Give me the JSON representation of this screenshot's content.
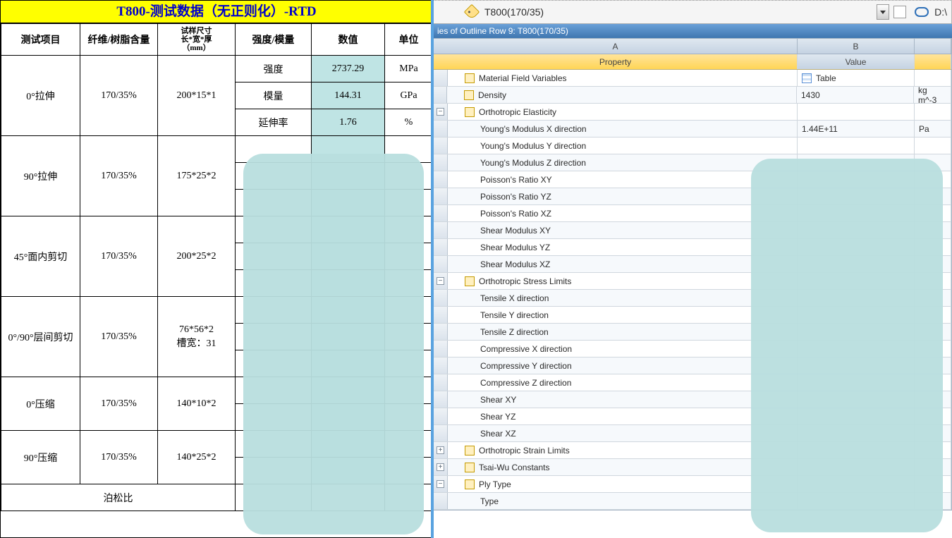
{
  "sheet": {
    "title": "T800-测试数据（无正则化）-RTD",
    "headers": {
      "test": "测试项目",
      "fiber": "纤维/树脂含量",
      "size_top": "试样尺寸",
      "size_mid": "长*宽*厚",
      "size_unit": "（mm）",
      "prop": "强度/模量",
      "value": "数值",
      "unit": "单位"
    },
    "rows": [
      {
        "test": "0°拉伸",
        "fiber": "170/35%",
        "size": "200*15*1",
        "props": [
          {
            "name": "强度",
            "value": "2737.29",
            "unit": "MPa"
          },
          {
            "name": "模量",
            "value": "144.31",
            "unit": "GPa"
          },
          {
            "name": "延伸率",
            "value": "1.76",
            "unit": "%"
          }
        ]
      },
      {
        "test": "90°拉伸",
        "fiber": "170/35%",
        "size": "175*25*2",
        "props": [
          {},
          {},
          {}
        ]
      },
      {
        "test": "45°面内剪切",
        "fiber": "170/35%",
        "size": "200*25*2",
        "props": [
          {},
          {},
          {}
        ]
      },
      {
        "test": "0°/90°层间剪切",
        "fiber": "170/35%",
        "size": "76*56*2",
        "size2": "槽宽：31",
        "props": [
          {},
          {},
          {}
        ]
      },
      {
        "test": "0°压缩",
        "fiber": "170/35%",
        "size": "140*10*2",
        "props": [
          {},
          {}
        ]
      },
      {
        "test": "90°压缩",
        "fiber": "170/35%",
        "size": "140*25*2",
        "props": [
          {},
          {}
        ]
      }
    ],
    "footer": "泊松比"
  },
  "toolbar": {
    "material_name": "T800(170/35)",
    "path_label": "D:\\"
  },
  "panel": {
    "title": "ies of Outline Row 9: T800(170/35)",
    "col_letters": {
      "A": "A",
      "B": "B"
    },
    "col_headers": {
      "A": "Property",
      "B": "Value"
    },
    "rows": [
      {
        "exp": "",
        "icon": "prop",
        "indent": 1,
        "label": "Material Field Variables",
        "value_icon": "table",
        "value": "Table",
        "unit": ""
      },
      {
        "exp": "",
        "icon": "prop",
        "indent": 1,
        "label": "Density",
        "value": "1430",
        "unit": "kg m^-3"
      },
      {
        "exp": "-",
        "icon": "prop",
        "indent": 1,
        "label": "Orthotropic Elasticity",
        "value": "",
        "unit": ""
      },
      {
        "exp": "",
        "icon": "",
        "indent": 2,
        "label": "Young's Modulus X direction",
        "value": "1.44E+11",
        "unit": "Pa"
      },
      {
        "exp": "",
        "icon": "",
        "indent": 2,
        "label": "Young's Modulus Y direction",
        "value": "",
        "unit": ""
      },
      {
        "exp": "",
        "icon": "",
        "indent": 2,
        "label": "Young's Modulus Z direction",
        "value": "",
        "unit": ""
      },
      {
        "exp": "",
        "icon": "",
        "indent": 2,
        "label": "Poisson's Ratio XY",
        "value": "",
        "unit": ""
      },
      {
        "exp": "",
        "icon": "",
        "indent": 2,
        "label": "Poisson's Ratio YZ",
        "value": "",
        "unit": ""
      },
      {
        "exp": "",
        "icon": "",
        "indent": 2,
        "label": "Poisson's Ratio XZ",
        "value": "",
        "unit": ""
      },
      {
        "exp": "",
        "icon": "",
        "indent": 2,
        "label": "Shear Modulus XY",
        "value": "",
        "unit": ""
      },
      {
        "exp": "",
        "icon": "",
        "indent": 2,
        "label": "Shear Modulus YZ",
        "value": "",
        "unit": ""
      },
      {
        "exp": "",
        "icon": "",
        "indent": 2,
        "label": "Shear Modulus XZ",
        "value": "",
        "unit": ""
      },
      {
        "exp": "-",
        "icon": "prop",
        "indent": 1,
        "label": "Orthotropic Stress Limits",
        "value": "",
        "unit": ""
      },
      {
        "exp": "",
        "icon": "",
        "indent": 2,
        "label": "Tensile X direction",
        "value": "",
        "unit": ""
      },
      {
        "exp": "",
        "icon": "",
        "indent": 2,
        "label": "Tensile Y direction",
        "value": "",
        "unit": ""
      },
      {
        "exp": "",
        "icon": "",
        "indent": 2,
        "label": "Tensile Z direction",
        "value": "",
        "unit": ""
      },
      {
        "exp": "",
        "icon": "",
        "indent": 2,
        "label": "Compressive X direction",
        "value": "",
        "unit": ""
      },
      {
        "exp": "",
        "icon": "",
        "indent": 2,
        "label": "Compressive Y direction",
        "value": "",
        "unit": ""
      },
      {
        "exp": "",
        "icon": "",
        "indent": 2,
        "label": "Compressive Z direction",
        "value": "",
        "unit": ""
      },
      {
        "exp": "",
        "icon": "",
        "indent": 2,
        "label": "Shear XY",
        "value": "",
        "unit": ""
      },
      {
        "exp": "",
        "icon": "",
        "indent": 2,
        "label": "Shear YZ",
        "value": "",
        "unit": ""
      },
      {
        "exp": "",
        "icon": "",
        "indent": 2,
        "label": "Shear XZ",
        "value": "",
        "unit": ""
      },
      {
        "exp": "+",
        "icon": "prop",
        "indent": 1,
        "label": "Orthotropic Strain Limits",
        "value": "",
        "unit": ""
      },
      {
        "exp": "+",
        "icon": "prop",
        "indent": 1,
        "label": "Tsai-Wu Constants",
        "value": "",
        "unit": ""
      },
      {
        "exp": "-",
        "icon": "prop",
        "indent": 1,
        "label": "Ply Type",
        "value": "",
        "unit": ""
      },
      {
        "exp": "",
        "icon": "",
        "indent": 2,
        "label": "Type",
        "value": "",
        "unit": ""
      }
    ]
  }
}
